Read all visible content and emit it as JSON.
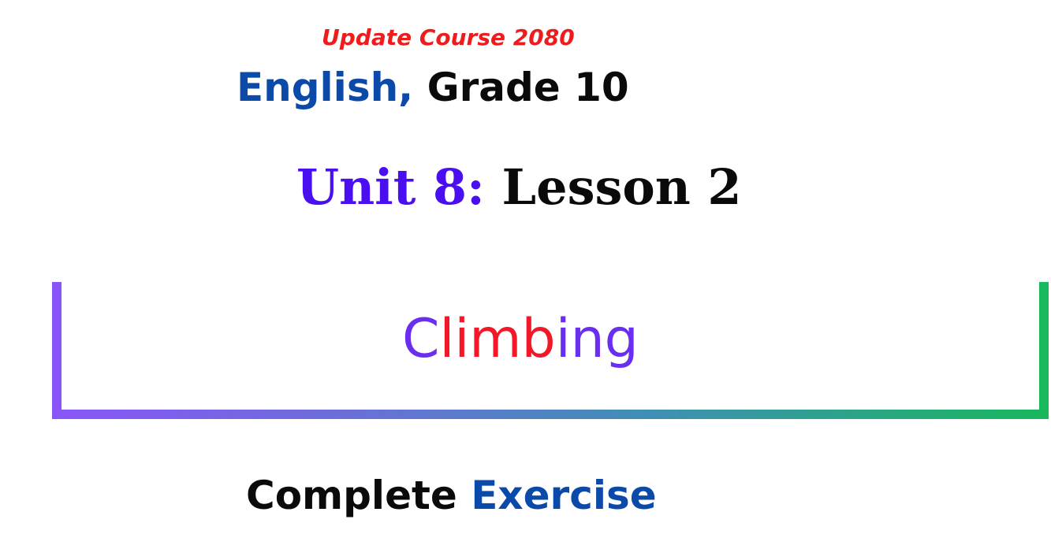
{
  "header": {
    "update_text": "Update Course 2080",
    "subject": "English,",
    "grade": " Grade 10"
  },
  "unit": {
    "unit_label": "Unit 8:",
    "lesson_label": " Lesson 2"
  },
  "title": {
    "part1": "C",
    "part2": "limb",
    "part3": "ing"
  },
  "footer": {
    "word1": "Complete",
    "word2": " Exercise"
  },
  "colors": {
    "update_red": "#ee1c1c",
    "subject_blue": "#0b4aa8",
    "unit_purple": "#4a0ff0",
    "title_purple": "#6a2ef0",
    "title_red": "#f2182a",
    "black": "#0a0a0a",
    "bracket_start": "#8a55f8",
    "bracket_end": "#18b85c"
  }
}
